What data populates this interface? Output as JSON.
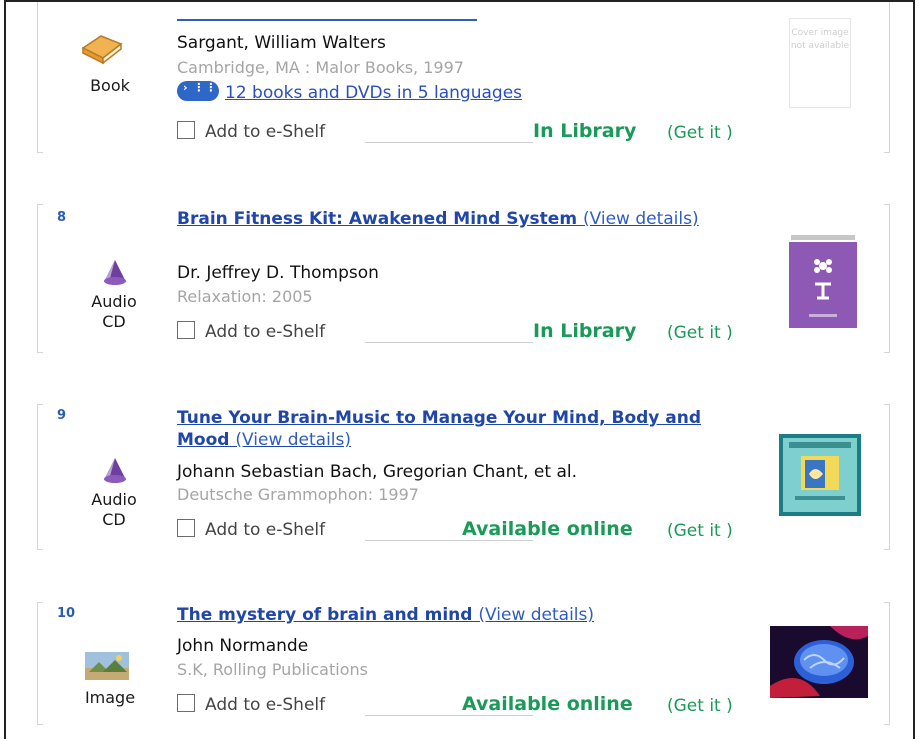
{
  "records": [
    {
      "number": "",
      "type_label": "Book",
      "type_icon": "book-icon",
      "title": "",
      "author": "Sargant, William Walters",
      "publication": "Cambridge, MA : Malor Books, 1997",
      "versions_link": "12 books and DVDs in 5 languages",
      "shelf_label": "Add to e-Shelf",
      "availability": "In Library",
      "getit": "(Get it )",
      "cover_text": "Cover image not available"
    },
    {
      "number": "8",
      "type_label": "Audio CD",
      "type_icon": "audio-cd-icon",
      "title": "Brain Fitness Kit: Awakened Mind System",
      "view_details": "(View details)",
      "author": "Dr. Jeffrey D. Thompson",
      "publication": "Relaxation: 2005",
      "shelf_label": "Add to e-Shelf",
      "availability": "In Library",
      "getit": "(Get it )"
    },
    {
      "number": "9",
      "type_label": "Audio CD",
      "type_icon": "audio-cd-icon",
      "title": "Tune Your Brain-Music to Manage Your Mind, Body and Mood",
      "view_details": "(View details)",
      "author": "Johann Sebastian Bach, Gregorian Chant, et al.",
      "publication": "Deutsche Grammophon: 1997",
      "shelf_label": "Add to e-Shelf",
      "availability": "Available online",
      "getit": "(Get it )"
    },
    {
      "number": "10",
      "type_label": "Image",
      "type_icon": "image-icon",
      "title": "The mystery of brain and mind",
      "view_details": "(View details)",
      "author": "John Normande",
      "publication": "S.K, Rolling Publications",
      "shelf_label": "Add to e-Shelf",
      "availability": "Available online",
      "getit": "(Get it )"
    }
  ],
  "colors": {
    "link_blue": "#1f46a8",
    "availability_green": "#1a9a58",
    "publisher_gray": "#a5a5a5"
  }
}
